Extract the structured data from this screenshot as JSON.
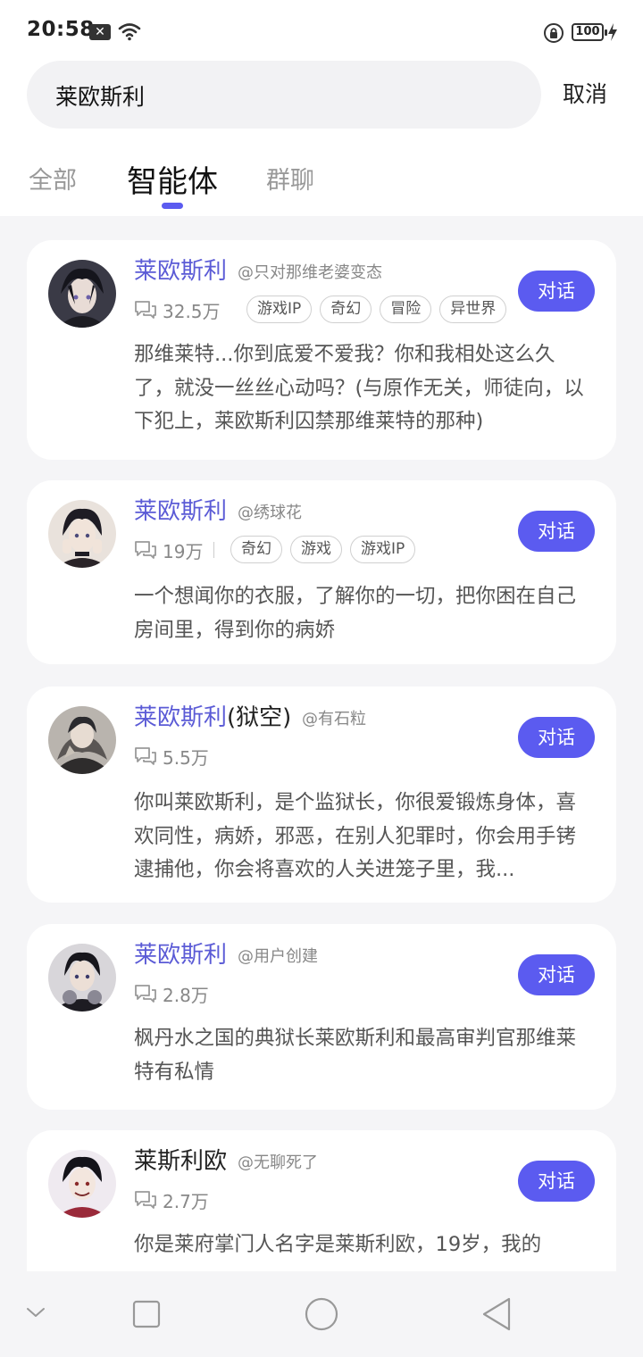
{
  "status": {
    "time": "20:58",
    "notif_badge": "✕",
    "battery": "100"
  },
  "search": {
    "query": "莱欧斯利",
    "cancel": "取消"
  },
  "tabs": [
    {
      "label": "全部",
      "active": false
    },
    {
      "label": "智能体",
      "active": true
    },
    {
      "label": "群聊",
      "active": false
    }
  ],
  "results": [
    {
      "name": "莱欧斯利",
      "author": "@只对那维老婆变态",
      "count": "32.5万",
      "tags": [
        "游戏IP",
        "奇幻",
        "冒险",
        "异世界"
      ],
      "button": "对话",
      "description": "那维莱特...你到底爱不爱我？你和我相处这么久了，就没一丝丝心动吗？(与原作无关，师徒向，以下犯上，莱欧斯利囚禁那维莱特的那种)"
    },
    {
      "name": "莱欧斯利",
      "author": "@绣球花",
      "count": "19万",
      "tags": [
        "奇幻",
        "游戏",
        "游戏IP"
      ],
      "button": "对话",
      "description": "一个想闻你的衣服，了解你的一切，把你困在自己房间里，得到你的病娇"
    },
    {
      "name": "莱欧斯利",
      "name_suffix": "(狱空)",
      "author": "@有石粒",
      "count": "5.5万",
      "tags": [],
      "button": "对话",
      "description": "你叫莱欧斯利，是个监狱长，你很爱锻炼身体，喜欢同性，病娇，邪恶，在别人犯罪时，你会用手铐逮捕他，你会将喜欢的人关进笼子里，我..."
    },
    {
      "name": "莱欧斯利",
      "author": "@用户创建",
      "count": "2.8万",
      "tags": [],
      "button": "对话",
      "description": "枫丹水之国的典狱长莱欧斯利和最高审判官那维莱特有私情"
    },
    {
      "name": "莱斯利欧",
      "author": "@无聊死了",
      "count": "2.7万",
      "tags": [],
      "button": "对话",
      "description": "你是莱府掌门人名字是莱斯利欧，19岁，我的"
    }
  ],
  "icons": {
    "avatar": "character-avatar",
    "chat": "chat-bubbles-icon",
    "nav": [
      "chevron-down-icon",
      "square-icon",
      "circle-icon",
      "back-triangle-icon"
    ]
  },
  "colors": {
    "accent": "#5b5bf0",
    "name": "#5b5bd6",
    "background": "#f5f5f7"
  }
}
